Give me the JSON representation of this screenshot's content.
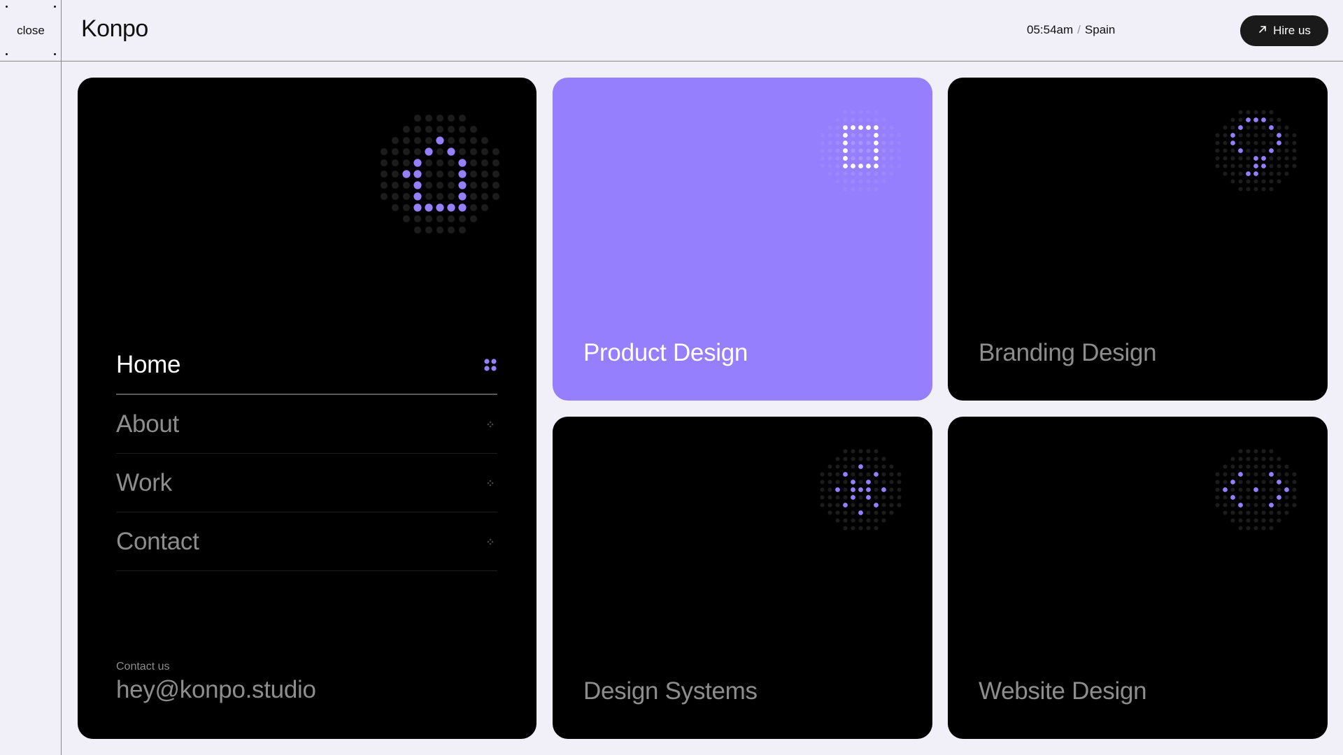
{
  "rail": {
    "close_label": "close"
  },
  "header": {
    "logo": "Konpo",
    "time": "05:54am",
    "separator": "/",
    "location": "Spain",
    "hire_label": "Hire us",
    "hire_icon": "arrow-up-right-icon"
  },
  "nav": {
    "items": [
      {
        "label": "Home",
        "active": true
      },
      {
        "label": "About",
        "active": false
      },
      {
        "label": "Work",
        "active": false
      },
      {
        "label": "Contact",
        "active": false
      }
    ],
    "contact_label": "Contact us",
    "contact_email": "hey@konpo.studio"
  },
  "services": [
    {
      "label": "Product Design",
      "highlighted": true
    },
    {
      "label": "Branding Design",
      "highlighted": false
    },
    {
      "label": "Design Systems",
      "highlighted": false
    },
    {
      "label": "Website Design",
      "highlighted": false
    }
  ],
  "colors": {
    "accent": "#967ffd",
    "background": "#f1eff8",
    "card": "#000000",
    "muted_text": "#8d8d8d"
  }
}
